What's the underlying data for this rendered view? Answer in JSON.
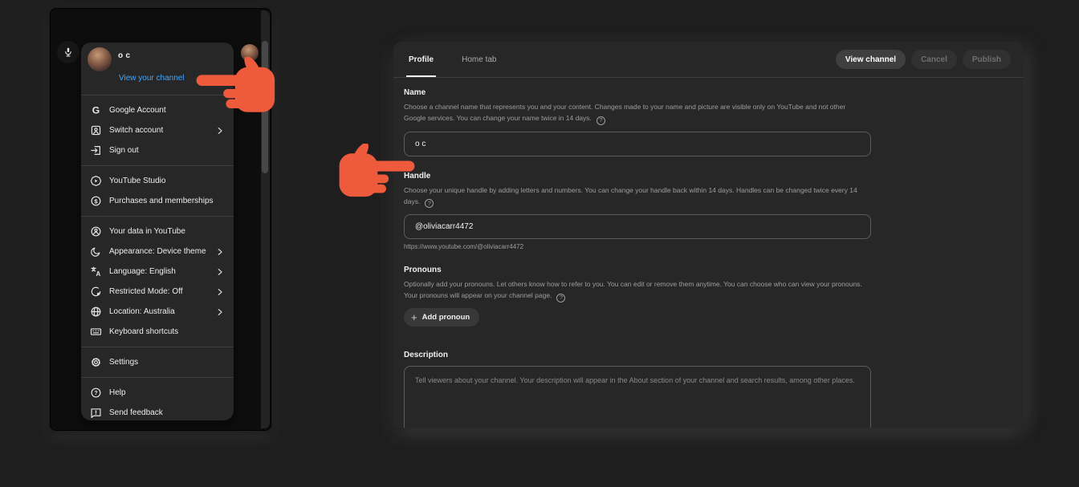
{
  "theme": {
    "page_bg": "#1e1e1e",
    "panel_bg": "#272727",
    "accent_blue": "#3ea6ff",
    "hand_color": "#ed5a3c"
  },
  "left_panel": {
    "menu": {
      "user_name": "o c",
      "view_channel_link": "View your channel",
      "sections": [
        {
          "items": [
            {
              "label": "Google Account",
              "icon": "google-icon",
              "has_submenu": false
            },
            {
              "label": "Switch account",
              "icon": "switch-account-icon",
              "has_submenu": true
            },
            {
              "label": "Sign out",
              "icon": "sign-out-icon",
              "has_submenu": false
            }
          ]
        },
        {
          "items": [
            {
              "label": "YouTube Studio",
              "icon": "youtube-studio-icon",
              "has_submenu": false
            },
            {
              "label": "Purchases and memberships",
              "icon": "purchases-icon",
              "has_submenu": false
            }
          ]
        },
        {
          "items": [
            {
              "label": "Your data in YouTube",
              "icon": "your-data-icon",
              "has_submenu": false
            },
            {
              "label": "Appearance: Device theme",
              "icon": "appearance-icon",
              "has_submenu": true
            },
            {
              "label": "Language: English",
              "icon": "language-icon",
              "has_submenu": true
            },
            {
              "label": "Restricted Mode: Off",
              "icon": "restricted-mode-icon",
              "has_submenu": true
            },
            {
              "label": "Location: Australia",
              "icon": "location-icon",
              "has_submenu": true
            },
            {
              "label": "Keyboard shortcuts",
              "icon": "keyboard-icon",
              "has_submenu": false
            }
          ]
        },
        {
          "items": [
            {
              "label": "Settings",
              "icon": "settings-icon",
              "has_submenu": false
            }
          ]
        },
        {
          "items": [
            {
              "label": "Help",
              "icon": "help-icon",
              "has_submenu": false
            },
            {
              "label": "Send feedback",
              "icon": "feedback-icon",
              "has_submenu": false
            }
          ]
        }
      ]
    }
  },
  "right_panel": {
    "tabs": [
      {
        "label": "Profile"
      },
      {
        "label": "Home tab"
      }
    ],
    "actions": [
      {
        "label": "View channel",
        "enabled": true
      },
      {
        "label": "Cancel",
        "enabled": false
      },
      {
        "label": "Publish",
        "enabled": false
      }
    ],
    "name": {
      "label": "Name",
      "help_line1": "Choose a channel name that represents you and your content. Changes made to your name and picture are visible only on YouTube and not other",
      "help_line2": "Google services. You can change your name twice in 14 days.",
      "value": "o c"
    },
    "handle": {
      "label": "Handle",
      "help_line1": "Choose your unique handle by adding letters and numbers. You can change your handle back within 14 days. Handles can be changed twice every 14",
      "help_line2": "days.",
      "value": "@oliviacarr4472",
      "url": "https://www.youtube.com/@oliviacarr4472"
    },
    "pronouns": {
      "label": "Pronouns",
      "help_line1": "Optionally add your pronouns. Let others know how to refer to you. You can edit or remove them anytime. You can choose who can view your pronouns.",
      "help_line2": "Your pronouns will appear on your channel page.",
      "button_label": "Add pronoun"
    },
    "description": {
      "label": "Description",
      "placeholder": "Tell viewers about your channel. Your description will appear in the About section of your channel and search results, among other places."
    }
  }
}
